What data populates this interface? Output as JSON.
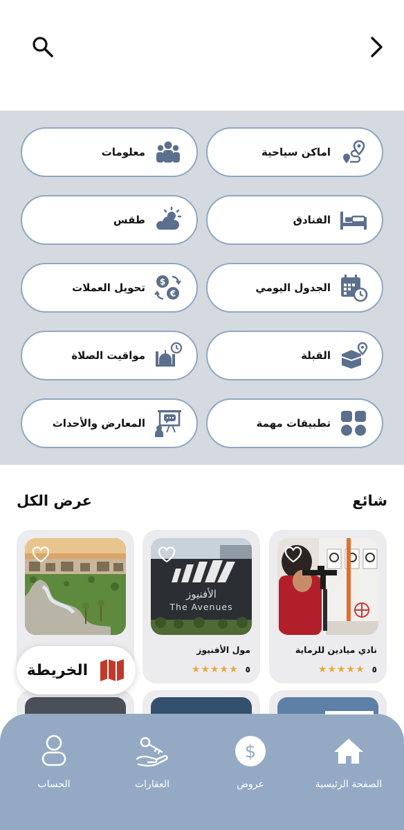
{
  "colors": {
    "accent": "#5b6f8e",
    "pill_border": "#8fa7c2",
    "section_bg": "#d5dae0",
    "nav_bg": "#94aac4",
    "star": "#e8a93a",
    "map_red": "#c0392b"
  },
  "top_bar": {
    "search_icon": "search-icon",
    "back_icon": "chevron-right-icon"
  },
  "menu": [
    {
      "label": "اماكن سياحية",
      "icon": "map-route-icon"
    },
    {
      "label": "معلومات",
      "icon": "people-group-icon"
    },
    {
      "label": "الفنادق",
      "icon": "bed-icon"
    },
    {
      "label": "طقس",
      "icon": "weather-icon"
    },
    {
      "label": "الجدول اليومي",
      "icon": "calendar-clock-icon"
    },
    {
      "label": "تحويل العملات",
      "icon": "currency-exchange-icon"
    },
    {
      "label": "القبلة",
      "icon": "kaaba-icon"
    },
    {
      "label": "مواقيت الصلاة",
      "icon": "mosque-clock-icon"
    },
    {
      "label": "تطبيقات مهمة",
      "icon": "apps-grid-icon"
    },
    {
      "label": "المعارض والأحداث",
      "icon": "presentation-icon"
    }
  ],
  "popular": {
    "title": "شائع",
    "view_all": "عرض الكل",
    "cards": [
      {
        "title": "نادي ميادين للرماية",
        "rating": "٥",
        "stars": "★★★★★"
      },
      {
        "title": "مول الأفنيوز",
        "rating": "٥",
        "stars": "★★★★★",
        "sign_arabic": "الأفنيوز",
        "sign_english": "The Avenues"
      },
      {
        "title": "",
        "rating": "",
        "stars": ""
      }
    ]
  },
  "map_button": {
    "label": "الخريطة"
  },
  "bottom_nav": [
    {
      "label": "الصفحة الرئيسية",
      "icon": "home-icon",
      "active": true
    },
    {
      "label": "عروض",
      "icon": "dollar-icon"
    },
    {
      "label": "العقارات",
      "icon": "key-hand-icon"
    },
    {
      "label": "الحساب",
      "icon": "user-icon"
    }
  ]
}
